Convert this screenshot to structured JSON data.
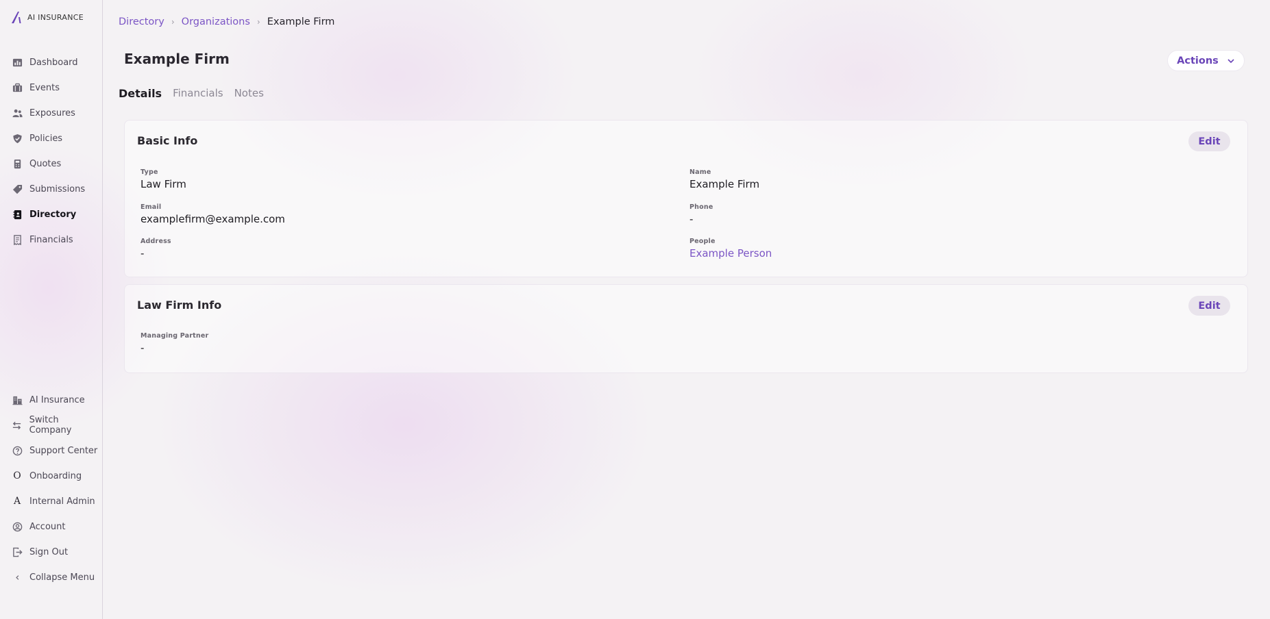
{
  "app": {
    "logo_text": "AI INSURANCE"
  },
  "sidebar": {
    "items": [
      {
        "label": "Dashboard",
        "icon": "chart-icon"
      },
      {
        "label": "Events",
        "icon": "briefcase-icon"
      },
      {
        "label": "Exposures",
        "icon": "users-icon"
      },
      {
        "label": "Policies",
        "icon": "shield-icon"
      },
      {
        "label": "Quotes",
        "icon": "calculator-icon"
      },
      {
        "label": "Submissions",
        "icon": "tag-icon"
      },
      {
        "label": "Directory",
        "icon": "address-book-icon",
        "active": true
      },
      {
        "label": "Financials",
        "icon": "receipt-icon"
      }
    ],
    "bottom_items": [
      {
        "label": "AI Insurance",
        "icon": "building-icon"
      },
      {
        "label": "Switch Company",
        "icon": "switch-icon"
      },
      {
        "label": "Support Center",
        "icon": "help-icon"
      },
      {
        "label": "Onboarding",
        "icon": "letter-o",
        "glyph": "O"
      },
      {
        "label": "Internal Admin",
        "icon": "letter-a",
        "glyph": "A"
      },
      {
        "label": "Account",
        "icon": "account-icon"
      },
      {
        "label": "Sign Out",
        "icon": "sign-out-icon"
      },
      {
        "label": "Collapse Menu",
        "icon": "chevron-left-icon"
      }
    ]
  },
  "breadcrumb": {
    "items": [
      "Directory",
      "Organizations"
    ],
    "current": "Example Firm"
  },
  "page": {
    "title": "Example Firm",
    "actions_label": "Actions"
  },
  "tabs": [
    {
      "label": "Details",
      "active": true
    },
    {
      "label": "Financials"
    },
    {
      "label": "Notes"
    }
  ],
  "basic_info": {
    "title": "Basic Info",
    "edit_label": "Edit",
    "fields": {
      "type": {
        "label": "Type",
        "value": "Law Firm"
      },
      "name": {
        "label": "Name",
        "value": "Example Firm"
      },
      "email": {
        "label": "Email",
        "value": "examplefirm@example.com"
      },
      "phone": {
        "label": "Phone",
        "value": "-"
      },
      "address": {
        "label": "Address",
        "value": "-"
      },
      "people": {
        "label": "People",
        "value": "Example Person"
      }
    }
  },
  "law_firm_info": {
    "title": "Law Firm Info",
    "edit_label": "Edit",
    "fields": {
      "managing_partner": {
        "label": "Managing Partner",
        "value": "-"
      }
    }
  },
  "colors": {
    "accent": "#7b55c5",
    "accent_dark": "#6a45b8",
    "background": "#f4f2f4"
  }
}
